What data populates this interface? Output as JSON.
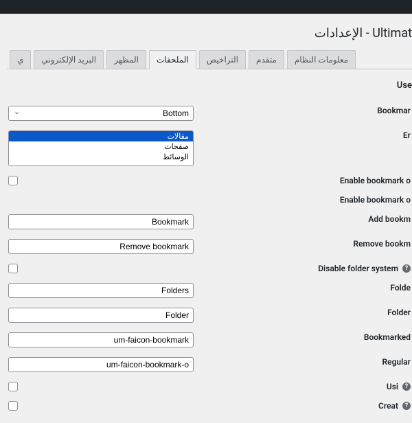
{
  "page_title": "Ultimat - الإعدادات",
  "tabs": [
    {
      "label": "ي"
    },
    {
      "label": "البريد الإلكتروني"
    },
    {
      "label": "المظهر"
    },
    {
      "label": "الملحقات",
      "active": true
    },
    {
      "label": "التراخيص"
    },
    {
      "label": "متقدم"
    },
    {
      "label": "معلومات النظام"
    }
  ],
  "section": "Use",
  "rows": {
    "bookmark_position": {
      "label": "Bookmar",
      "value": "Bottom"
    },
    "enable_for": {
      "label": "Er",
      "options": [
        "مقالات",
        "صفحات",
        "الوسائط"
      ]
    },
    "enable_bookmark_on": {
      "label": "Enable bookmark o"
    },
    "enable_bookmark_on2": {
      "label": "Enable bookmark o"
    },
    "add_bookmark": {
      "label": "Add bookm",
      "value": "Bookmark"
    },
    "remove_bookmark": {
      "label": "Remove bookm",
      "value": "Remove bookmark"
    },
    "disable_folder": {
      "label": "Disable folder system",
      "help": true
    },
    "folders": {
      "label": "Folde",
      "value": "Folders"
    },
    "folder": {
      "label": "Folder",
      "value": "Folder"
    },
    "bookmarked_icon": {
      "label": "Bookmarked",
      "value": "um-faicon-bookmark"
    },
    "regular_icon": {
      "label": "Regular",
      "value": "um-faicon-bookmark-o"
    },
    "using": {
      "label": "Usi",
      "help": true
    },
    "create": {
      "label": "Creat",
      "help": true
    }
  }
}
